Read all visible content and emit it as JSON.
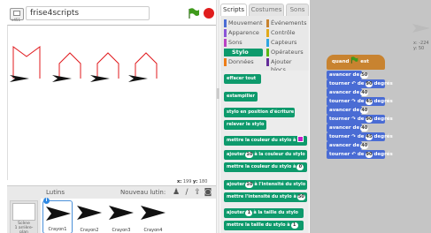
{
  "project": {
    "version": "v451",
    "title": "frise4scripts"
  },
  "stage": {
    "x_label": "x:",
    "x_value": "199",
    "y_label": "y:",
    "y_value": "180"
  },
  "sprites_pane": {
    "label": "Lutins",
    "new_sprite_label": "Nouveau lutin:",
    "stage_label": "Scène",
    "stage_sublabel": "1 arrière-plan",
    "sprites": [
      {
        "name": "Crayon1"
      },
      {
        "name": "Crayon2"
      },
      {
        "name": "Crayon3"
      },
      {
        "name": "Crayon4"
      }
    ],
    "info_glyph": "i"
  },
  "tabs": [
    {
      "label": "Scripts"
    },
    {
      "label": "Costumes"
    },
    {
      "label": "Sons"
    }
  ],
  "categories": [
    {
      "label": "Mouvement",
      "color": "#4a6cd4"
    },
    {
      "label": "Événements",
      "color": "#c88330"
    },
    {
      "label": "Apparence",
      "color": "#8a55d7"
    },
    {
      "label": "Contrôle",
      "color": "#e1a91a"
    },
    {
      "label": "Sons",
      "color": "#bb42c3"
    },
    {
      "label": "Capteurs",
      "color": "#2ca5e2"
    },
    {
      "label": "Stylo",
      "color": "#0e9a6c"
    },
    {
      "label": "Opérateurs",
      "color": "#5cb712"
    },
    {
      "label": "Données",
      "color": "#ee7d16"
    },
    {
      "label": "Ajouter blocs",
      "color": "#632d99"
    }
  ],
  "pen_blocks": [
    {
      "text": "effacer tout"
    },
    {
      "text": "estampiller"
    },
    {
      "text": "stylo en position d'écriture"
    },
    {
      "text": "relever le stylo"
    },
    {
      "text": "mettre la couleur du stylo à"
    },
    {
      "pre": "ajouter",
      "num": "10",
      "post": "à la couleur du stylo"
    },
    {
      "pre": "mettre la couleur du stylo à",
      "num": "0",
      "post": ""
    },
    {
      "pre": "ajouter",
      "num": "10",
      "post": "à l'intensité du stylo"
    },
    {
      "pre": "mettre l'intensité du stylo à",
      "num": "50",
      "post": ""
    },
    {
      "pre": "ajouter",
      "num": "1",
      "post": "à la taille du stylo"
    },
    {
      "pre": "mettre la taille du stylo à",
      "num": "1",
      "post": ""
    }
  ],
  "script": {
    "hat": {
      "pre": "quand",
      "post": "est cliqué"
    },
    "blocks": [
      {
        "pre": "avancer de",
        "num": "50",
        "post": ""
      },
      {
        "pre": "tourner ↶ de",
        "num": "90",
        "post": "degrés"
      },
      {
        "pre": "avancer de",
        "num": "40",
        "post": ""
      },
      {
        "pre": "tourner ↷ de",
        "num": "45",
        "post": "degrés"
      },
      {
        "pre": "avancer de",
        "num": "40",
        "post": ""
      },
      {
        "pre": "tourner ↷ de",
        "num": "90",
        "post": "degrés"
      },
      {
        "pre": "avancer de",
        "num": "40",
        "post": ""
      },
      {
        "pre": "tourner ↷ de",
        "num": "45",
        "post": "degrés"
      },
      {
        "pre": "avancer de",
        "num": "40",
        "post": ""
      },
      {
        "pre": "tourner ↶ de",
        "num": "90",
        "post": "degrés"
      }
    ]
  },
  "sprite_info": {
    "x_text": "x: -224",
    "y_text": "y: 50"
  },
  "colors": {
    "pen": "#0e9a6c",
    "motion": "#4a6cd4",
    "events": "#c88330",
    "drawing": "#e0191d",
    "flag": "#3f9a1c",
    "stop": "#e01d1d",
    "selection": "#4a90d9"
  },
  "icons": {
    "flag": "green-flag-icon",
    "stop": "stop-icon",
    "paint": "paintbrush-icon",
    "upload": "upload-icon",
    "camera": "camera-icon",
    "library": "sprite-library-icon"
  }
}
